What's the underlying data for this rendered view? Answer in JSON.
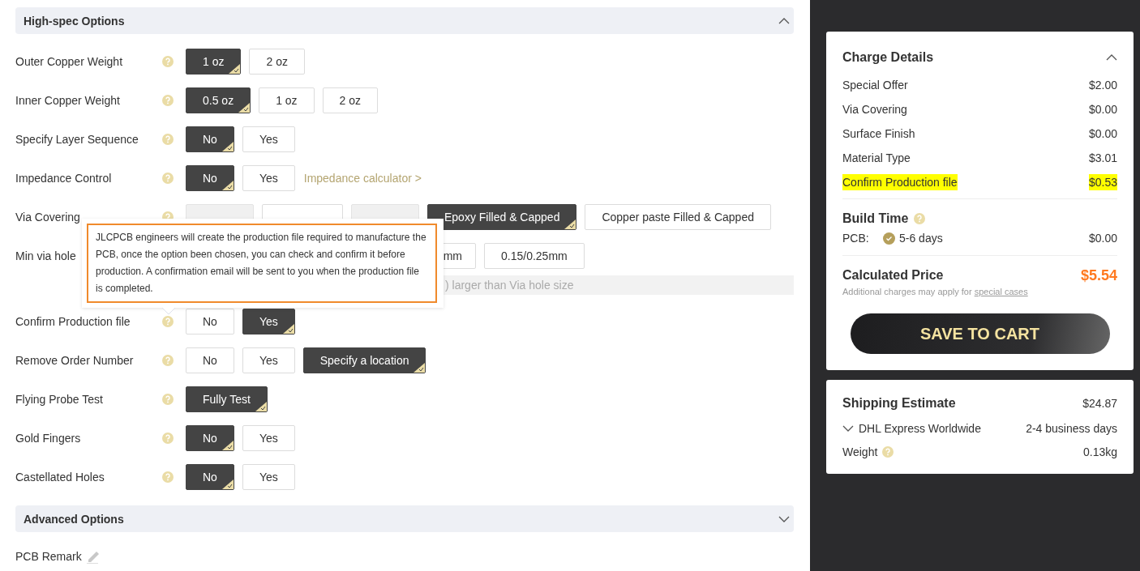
{
  "high_spec": {
    "title": "High-spec Options",
    "expanded": true,
    "rows": [
      {
        "label": "Outer Copper Weight",
        "help": true,
        "options": [
          {
            "label": "1 oz",
            "selected": true,
            "disabled": false
          },
          {
            "label": "2 oz",
            "selected": false,
            "disabled": false
          }
        ]
      },
      {
        "label": "Inner Copper Weight",
        "help": true,
        "options": [
          {
            "label": "0.5 oz",
            "selected": true,
            "disabled": false
          },
          {
            "label": "1 oz",
            "selected": false,
            "disabled": false
          },
          {
            "label": "2 oz",
            "selected": false,
            "disabled": false
          }
        ]
      },
      {
        "label": "Specify Layer Sequence",
        "help": true,
        "options": [
          {
            "label": "No",
            "selected": true,
            "disabled": false
          },
          {
            "label": "Yes",
            "selected": false,
            "disabled": false
          }
        ]
      },
      {
        "label": "Impedance Control",
        "help": true,
        "options": [
          {
            "label": "No",
            "selected": true,
            "disabled": false
          },
          {
            "label": "Yes",
            "selected": false,
            "disabled": false
          }
        ],
        "link": "Impedance calculator >"
      },
      {
        "label": "Via Covering",
        "help": true,
        "options": [
          {
            "selected": false,
            "disabled": true
          },
          {
            "selected": false,
            "disabled": false
          },
          {
            "selected": false,
            "disabled": true
          },
          {
            "label": "Epoxy Filled & Capped",
            "selected": true,
            "disabled": false
          },
          {
            "label": "Copper paste Filled & Capped",
            "selected": false,
            "disabled": false
          }
        ]
      },
      {
        "label": "Min via hole",
        "options": [
          {
            "label": "mm",
            "selected": false,
            "disabled": false,
            "partial": true
          },
          {
            "label": "0.15/0.25mm",
            "selected": false,
            "disabled": false
          }
        ],
        "note": ") larger than Via hole size"
      },
      {
        "label": "Confirm Production file",
        "help": true,
        "options": [
          {
            "label": "No",
            "selected": false,
            "disabled": false
          },
          {
            "label": "Yes",
            "selected": true,
            "disabled": false
          }
        ]
      },
      {
        "label": "Remove Order Number",
        "help": true,
        "options": [
          {
            "label": "No",
            "selected": false,
            "disabled": false
          },
          {
            "label": "Yes",
            "selected": false,
            "disabled": false
          },
          {
            "label": "Specify a location",
            "selected": true,
            "disabled": false
          }
        ]
      },
      {
        "label": "Flying Probe Test",
        "help": true,
        "options": [
          {
            "label": "Fully Test",
            "selected": true,
            "disabled": false
          }
        ]
      },
      {
        "label": "Gold Fingers",
        "help": true,
        "options": [
          {
            "label": "No",
            "selected": true,
            "disabled": false
          },
          {
            "label": "Yes",
            "selected": false,
            "disabled": false
          }
        ]
      },
      {
        "label": "Castellated Holes",
        "help": true,
        "options": [
          {
            "label": "No",
            "selected": true,
            "disabled": false
          },
          {
            "label": "Yes",
            "selected": false,
            "disabled": false
          }
        ]
      }
    ]
  },
  "tooltip": {
    "text": "JLCPCB engineers will create the production file required to manufacture the PCB, once the option been chosen, you can check and confirm it before production. A confirmation email will be sent to you when the production file is completed."
  },
  "advanced": {
    "title": "Advanced Options",
    "expanded": false
  },
  "pcb_remark": {
    "label": "PCB Remark"
  },
  "charge_details": {
    "title": "Charge Details",
    "expanded": true,
    "items": [
      {
        "label": "Special Offer",
        "amount": "$2.00",
        "highlighted": false
      },
      {
        "label": "Via Covering",
        "amount": "$0.00",
        "highlighted": false
      },
      {
        "label": "Surface Finish",
        "amount": "$0.00",
        "highlighted": false
      },
      {
        "label": "Material Type",
        "amount": "$3.01",
        "highlighted": false
      },
      {
        "label": "Confirm Production file",
        "amount": "$0.53",
        "highlighted": true
      }
    ],
    "build_time": {
      "title": "Build Time",
      "label": "PCB:",
      "option": "5-6 days",
      "amount": "$0.00"
    },
    "calculated": {
      "title": "Calculated Price",
      "amount": "$5.54",
      "note": "Additional charges may apply for",
      "link": "special cases"
    },
    "button": "SAVE TO CART"
  },
  "shipping": {
    "title": "Shipping Estimate",
    "amount": "$24.87",
    "method": "DHL Express Worldwide",
    "method_expanded": false,
    "time": "2-4 business days",
    "weight_label": "Weight",
    "weight": "0.13kg"
  }
}
